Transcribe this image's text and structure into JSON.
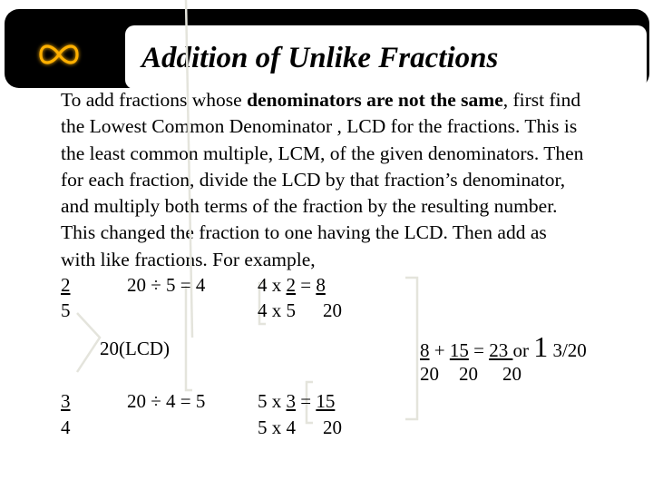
{
  "header": {
    "logo_icon": "infinity-icon",
    "title": "Addition of Unlike Fractions"
  },
  "paragraph": {
    "line1_a": "To add fractions whose ",
    "line1_bold": "denominators are not the same",
    "line1_b": ", first find",
    "line2": "the Lowest Common Denominator , LCD for the fractions. This is",
    "line3": "the least common multiple, LCM, of the given denominators. Then",
    "line4": "for each fraction, divide the LCD by that fraction’s denominator,",
    "line5": "and multiply  both terms of the fraction by the resulting number.",
    "line6": "This changed the fraction to one having the LCD. Then add  as",
    "line7": "with like fractions. For example,"
  },
  "example": {
    "fraction1": {
      "numerator": "2",
      "denominator": "5"
    },
    "division1": "20 ÷ 5 = 4",
    "multiply1": {
      "top_a": "4 x ",
      "top_num": "2",
      "equals": " = ",
      "result_num": "8",
      "bottom": "4 x 5",
      "result_den": "20"
    },
    "lcd_label": "20(LCD)",
    "fraction2": {
      "numerator": "3",
      "denominator": "4"
    },
    "division2": "20 ÷ 4 = 5",
    "multiply2": {
      "top_a": "5 x ",
      "top_num": "3",
      "equals": " = ",
      "result_num": "15",
      "bottom": "5 x 4",
      "result_den": "20"
    },
    "sum": {
      "n1": "8",
      "plus": " + ",
      "n2": "15",
      "equals": " = ",
      "n3": "23 ",
      "or": "or ",
      "whole": "1",
      "frac": " 3/20",
      "d1": "20",
      "d2": "20",
      "d3": "20"
    }
  }
}
